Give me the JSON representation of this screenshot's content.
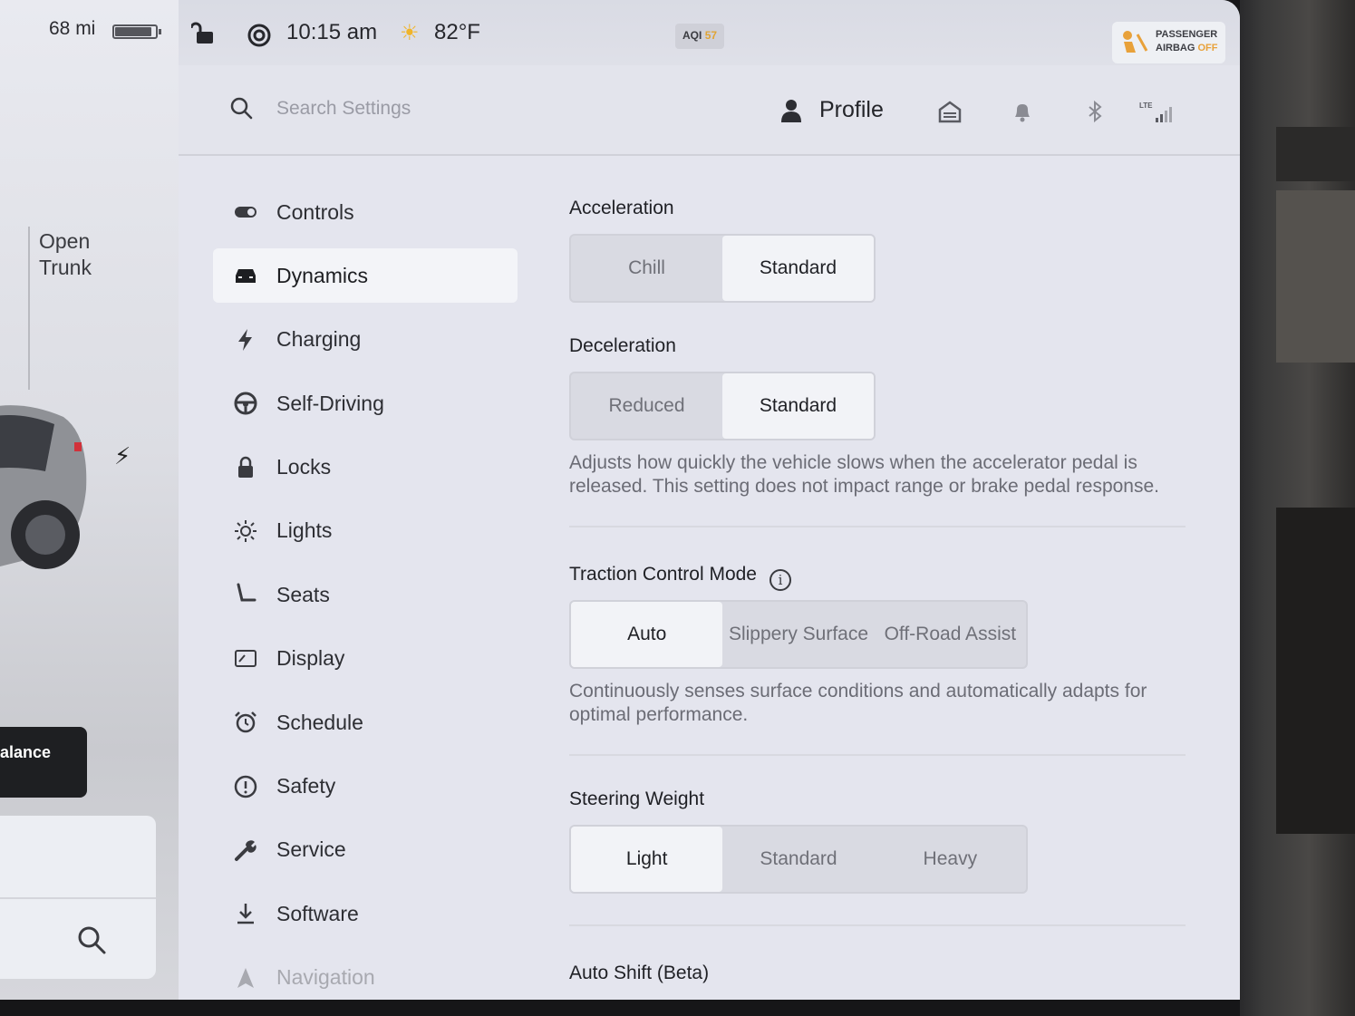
{
  "status_bar": {
    "range": "68 mi",
    "battery_level": 0.92,
    "time": "10:15 am",
    "temperature": "82°F",
    "aqi_label": "AQI",
    "aqi_value": "57",
    "airbag_line1": "PASSENGER",
    "airbag_line2": "AIRBAG",
    "airbag_state": "OFF"
  },
  "car_panel": {
    "open_trunk_line1": "Open",
    "open_trunk_line2": "Trunk",
    "balance_label": "alance"
  },
  "header": {
    "search_placeholder": "Search Settings",
    "profile_label": "Profile"
  },
  "nav": {
    "items": [
      {
        "label": "Controls",
        "icon": "toggle-icon"
      },
      {
        "label": "Dynamics",
        "icon": "car-icon",
        "active": true
      },
      {
        "label": "Charging",
        "icon": "bolt-icon"
      },
      {
        "label": "Self-Driving",
        "icon": "steering-wheel-icon"
      },
      {
        "label": "Locks",
        "icon": "lock-icon"
      },
      {
        "label": "Lights",
        "icon": "sun-icon"
      },
      {
        "label": "Seats",
        "icon": "seat-icon"
      },
      {
        "label": "Display",
        "icon": "display-icon"
      },
      {
        "label": "Schedule",
        "icon": "alarm-clock-icon"
      },
      {
        "label": "Safety",
        "icon": "alert-circle-icon"
      },
      {
        "label": "Service",
        "icon": "wrench-icon"
      },
      {
        "label": "Software",
        "icon": "download-icon"
      },
      {
        "label": "Navigation",
        "icon": "navigation-icon"
      }
    ]
  },
  "dynamics": {
    "acceleration": {
      "title": "Acceleration",
      "options": [
        "Chill",
        "Standard"
      ],
      "selected": "Standard"
    },
    "deceleration": {
      "title": "Deceleration",
      "options": [
        "Reduced",
        "Standard"
      ],
      "selected": "Standard",
      "description": "Adjusts how quickly the vehicle slows when the accelerator pedal is released. This setting does not impact range or brake pedal response."
    },
    "traction": {
      "title": "Traction Control Mode",
      "options": [
        "Auto",
        "Slippery Surface",
        "Off-Road Assist"
      ],
      "selected": "Auto",
      "description": "Continuously senses surface conditions and automatically adapts for optimal performance."
    },
    "steering": {
      "title": "Steering Weight",
      "options": [
        "Light",
        "Standard",
        "Heavy"
      ],
      "selected": "Light"
    },
    "auto_shift_title": "Auto Shift (Beta)"
  }
}
